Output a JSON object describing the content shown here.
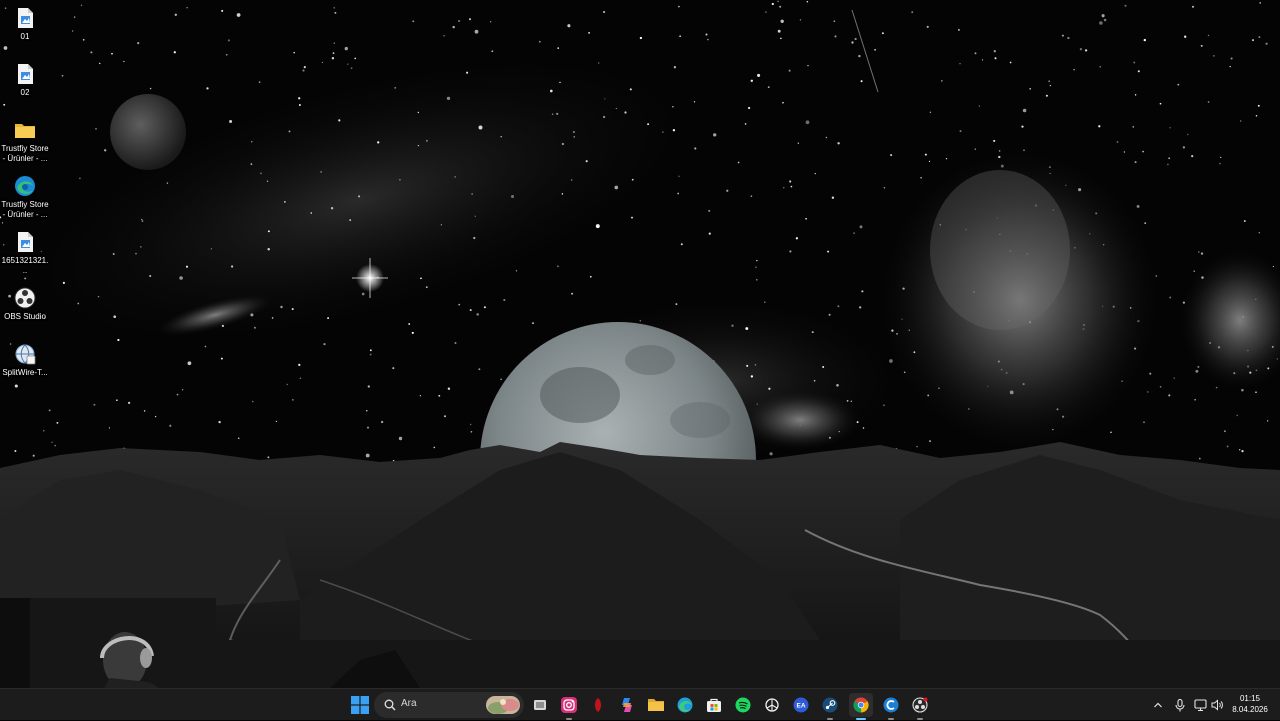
{
  "desktop": {
    "icons": [
      {
        "label": "01",
        "icon": "image-file-icon"
      },
      {
        "label": "02",
        "icon": "image-file-icon"
      },
      {
        "label": "Trustfiy Store - Ürünler - ...",
        "icon": "folder-icon"
      },
      {
        "label": "Trustfiy Store - Ürünler - ...",
        "icon": "edge-shortcut-icon"
      },
      {
        "label": "1651321321...",
        "icon": "image-file-icon"
      },
      {
        "label": "OBS Studio",
        "icon": "obs-icon"
      },
      {
        "label": "SplitWire-T...",
        "icon": "splitwire-icon"
      }
    ]
  },
  "taskbar": {
    "search": {
      "placeholder": "Ara"
    },
    "apps": [
      {
        "name": "start",
        "icon": "windows-start-icon",
        "color": "#3aa0f3"
      },
      {
        "name": "task-view",
        "icon": "task-view-icon",
        "color": "#cfcfcf"
      },
      {
        "name": "instagram",
        "icon": "instagram-icon",
        "color": "#e1306c"
      },
      {
        "name": "app-red",
        "icon": "red-app-icon",
        "color": "#c0141c"
      },
      {
        "name": "copilot",
        "icon": "copilot-icon",
        "color": "#7b61ff"
      },
      {
        "name": "file-explorer",
        "icon": "folder-icon",
        "color": "#f4c247"
      },
      {
        "name": "edge",
        "icon": "edge-icon",
        "color": "#1f9ede"
      },
      {
        "name": "store",
        "icon": "store-icon",
        "color": "#f5f5f5"
      },
      {
        "name": "spotify",
        "icon": "spotify-icon",
        "color": "#1ed760"
      },
      {
        "name": "chatgpt",
        "icon": "chatgpt-icon",
        "color": "#ffffff"
      },
      {
        "name": "ea",
        "icon": "ea-icon",
        "color": "#2f5bd8"
      },
      {
        "name": "steam",
        "icon": "steam-icon",
        "color": "#1b6fb0"
      },
      {
        "name": "chrome",
        "icon": "chrome-icon",
        "color": "#34a853"
      },
      {
        "name": "app-c",
        "icon": "c-app-icon",
        "color": "#2a9df4"
      },
      {
        "name": "obs",
        "icon": "obs-icon",
        "color": "#e0e0e0"
      }
    ],
    "tray": {
      "time": "01:15",
      "date": "8.04.2026"
    }
  }
}
